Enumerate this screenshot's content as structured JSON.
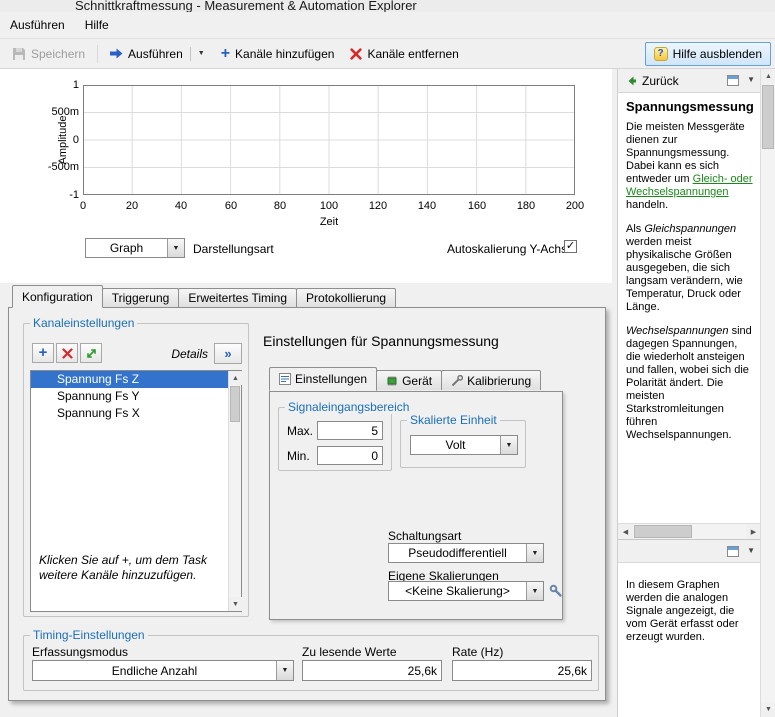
{
  "window": {
    "title": "Schnittkraftmessung - Measurement & Automation Explorer"
  },
  "menubar": {
    "items": [
      "Ausführen",
      "Hilfe"
    ]
  },
  "toolbar": {
    "save_label": "Speichern",
    "run_label": "Ausführen",
    "add_channels_label": "Kanäle hinzufügen",
    "remove_channels_label": "Kanäle entfernen",
    "hide_help_label": "Hilfe ausblenden"
  },
  "graph": {
    "ylabel": "Amplitude",
    "xlabel": "Zeit",
    "y_ticks": [
      "1",
      "500m",
      "0",
      "-500m",
      "-1"
    ],
    "x_ticks": [
      "0",
      "20",
      "40",
      "60",
      "80",
      "100",
      "120",
      "140",
      "160",
      "180",
      "200"
    ],
    "display_type_value": "Graph",
    "display_type_label": "Darstellungsart",
    "autoscale_label": "Autoskalierung Y-Achse",
    "autoscale_checked": true
  },
  "tabs": {
    "items": [
      "Konfiguration",
      "Triggerung",
      "Erweitertes Timing",
      "Protokollierung"
    ]
  },
  "channels": {
    "group_label": "Kanaleinstellungen",
    "details_label": "Details",
    "items": [
      "Spannung Fs Z",
      "Spannung Fs Y",
      "Spannung Fs X"
    ],
    "hint": "Klicken Sie auf +, um dem Task weitere Kanäle hinzuzufügen."
  },
  "settings": {
    "title": "Einstellungen für Spannungsmessung",
    "tabs": [
      "Einstellungen",
      "Gerät",
      "Kalibrierung"
    ],
    "signal_range_label": "Signaleingangsbereich",
    "max_label": "Max.",
    "max_value": "5",
    "min_label": "Min.",
    "min_value": "0",
    "unit_group_label": "Skalierte Einheit",
    "unit_value": "Volt",
    "terminal_label": "Schaltungsart",
    "terminal_value": "Pseudodifferentiell",
    "scaling_label": "Eigene Skalierungen",
    "scaling_value": "<Keine Skalierung>"
  },
  "timing": {
    "group_label": "Timing-Einstellungen",
    "mode_label": "Erfassungsmodus",
    "mode_value": "Endliche Anzahl",
    "samples_label": "Zu lesende Werte",
    "samples_value": "25,6k",
    "rate_label": "Rate (Hz)",
    "rate_value": "25,6k"
  },
  "help": {
    "back_label": "Zurück",
    "title": "Spannungsmessung",
    "p1_pre": "Die meisten Messgeräte dienen zur Spannungsmessung. Dabei kann es sich entweder um ",
    "p1_link": "Gleich- oder Wechselspannungen",
    "p1_post": " handeln.",
    "p2_pre": "Als ",
    "p2_em": "Gleichspannungen",
    "p2_post": " werden meist physikalische Größen ausgegeben, die sich langsam verändern, wie Temperatur, Druck oder Länge.",
    "p3_em": "Wechselspannungen",
    "p3_post": " sind dagegen Spannungen, die wiederholt ansteigen und fallen, wobei sich die Polarität ändert. Die meisten Starkstromleitungen führen Wechselspannungen.",
    "graph_note": "In diesem Graphen werden die analogen Signale angezeigt, die vom Gerät erfasst oder erzeugt wurden."
  },
  "icons": {
    "plus": "+",
    "details_chevrons": "»",
    "combo_arrow": "▼",
    "check": "✓",
    "up": "▲",
    "down": "▼",
    "left": "◀",
    "right": "▶",
    "question": "?"
  },
  "colors": {
    "group_label_blue": "#1a6fb8",
    "selection_blue": "#3373cc",
    "link_green": "#1c8a1a",
    "run_arrow_blue": "#2d5fc8",
    "remove_red": "#d42a2a"
  }
}
